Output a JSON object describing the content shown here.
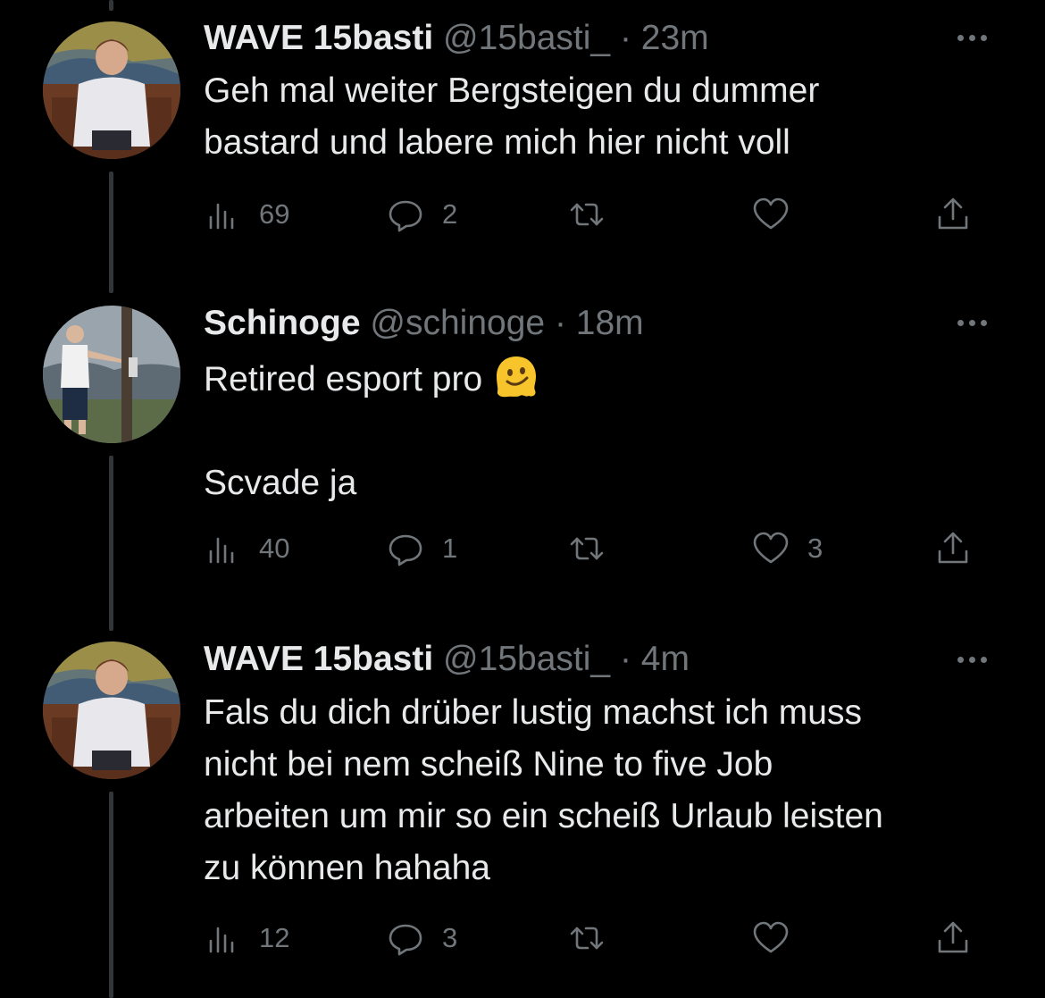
{
  "tweets": [
    {
      "name": "WAVE 15basti",
      "handle": "@15basti_",
      "separator": "·",
      "time": "23m",
      "lines": [
        "Geh mal weiter Bergsteigen du dummer",
        "bastard und labere mich hier nicht voll"
      ],
      "views": "69",
      "replies": "2",
      "retweets": "",
      "likes": ""
    },
    {
      "name": "Schinoge",
      "handle": "@schinoge",
      "separator": "·",
      "time": "18m",
      "line1": "Retired esport pro",
      "emoji": "melting-face-emoji",
      "line2": "Scvade ja",
      "views": "40",
      "replies": "1",
      "retweets": "",
      "likes": "3"
    },
    {
      "name": "WAVE 15basti",
      "handle": "@15basti_",
      "separator": "·",
      "time": "4m",
      "lines": [
        "Fals du dich drüber lustig machst ich muss",
        "nicht bei nem scheiß Nine to five Job",
        "arbeiten um mir so ein scheiß Urlaub leisten",
        "zu können hahaha"
      ],
      "views": "12",
      "replies": "3",
      "retweets": "",
      "likes": ""
    }
  ],
  "icons": {
    "views": "views-chart-icon",
    "reply": "reply-bubble-icon",
    "retweet": "retweet-icon",
    "like": "heart-icon",
    "share": "share-icon",
    "more": "more-dots-icon"
  },
  "colors": {
    "background": "#000000",
    "text": "#e7e9ea",
    "secondary": "#71767b",
    "thread_line": "#333639"
  }
}
